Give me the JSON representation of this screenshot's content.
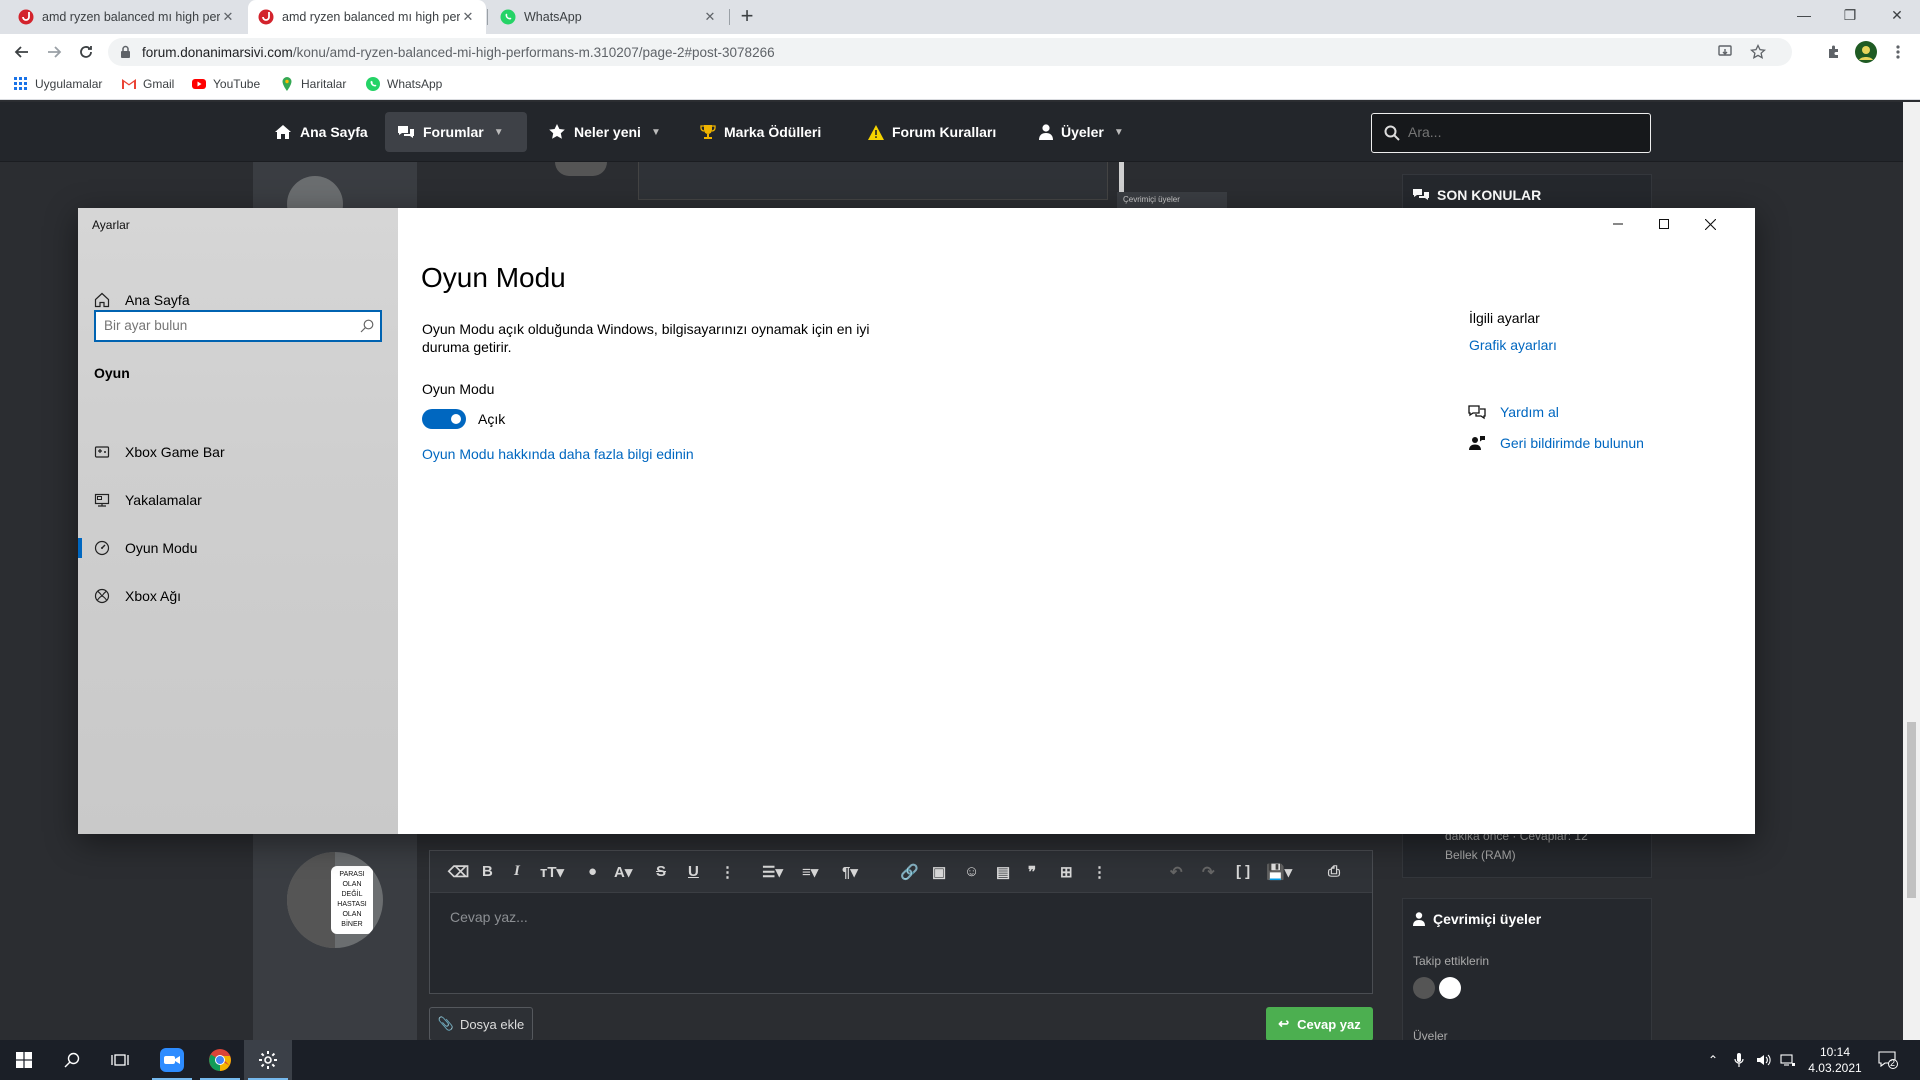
{
  "browser": {
    "tabs": [
      {
        "title": "amd ryzen balanced mı high perf",
        "active": false
      },
      {
        "title": "amd ryzen balanced mı high perf",
        "active": true
      },
      {
        "title": "WhatsApp",
        "active": false
      }
    ],
    "url_host": "forum.donanimarsivi.com",
    "url_path": "/konu/amd-ryzen-balanced-mi-high-performans-m.310207/page-2#post-3078266",
    "bookmarks": [
      "Uygulamalar",
      "Gmail",
      "YouTube",
      "Haritalar",
      "WhatsApp"
    ]
  },
  "forum": {
    "nav": [
      "Ana Sayfa",
      "Forumlar",
      "Neler yeni",
      "Marka Ödülleri",
      "Forum Kuralları",
      "Üyeler"
    ],
    "search_placeholder": "Ara...",
    "side_recent_title": "SON KONULAR",
    "side_recent_item_meta": "dakika önce · Cevaplar: 12",
    "side_recent_item_forum": "Bellek (RAM)",
    "side_online_title": "Çevrimiçi üyeler",
    "side_following_label": "Takip ettiklerin",
    "side_members_label": "Üyeler",
    "online_mini_label": "Çevrimiçi üyeler",
    "editor_placeholder": "Cevap yaz...",
    "attach_label": "Dosya ekle",
    "reply_label": "Cevap yaz",
    "avatar_text": [
      "PARASI",
      "OLAN",
      "DEĞİL",
      "HASTASI",
      "OLAN",
      "BİNER"
    ]
  },
  "settings": {
    "app_name": "Ayarlar",
    "home": "Ana Sayfa",
    "search_placeholder": "Bir ayar bulun",
    "section": "Oyun",
    "nav": [
      "Xbox Game Bar",
      "Yakalamalar",
      "Oyun Modu",
      "Xbox Ağı"
    ],
    "selected_index": 2,
    "page_title": "Oyun Modu",
    "description": "Oyun Modu açık olduğunda Windows, bilgisayarınızı oynamak için en iyi duruma getirir.",
    "toggle_label": "Oyun Modu",
    "toggle_state": "Açık",
    "learn_more": "Oyun Modu hakkında daha fazla bilgi edinin",
    "related_title": "İlgili ayarlar",
    "related_link": "Grafik ayarları",
    "help": "Yardım al",
    "feedback": "Geri bildirimde bulunun"
  },
  "taskbar": {
    "time": "10:14",
    "date": "4.03.2021",
    "notifications": "2"
  },
  "colors": {
    "accent": "#0067c0",
    "forum_bg": "#2b2d31",
    "reply_green": "#4caf50"
  }
}
